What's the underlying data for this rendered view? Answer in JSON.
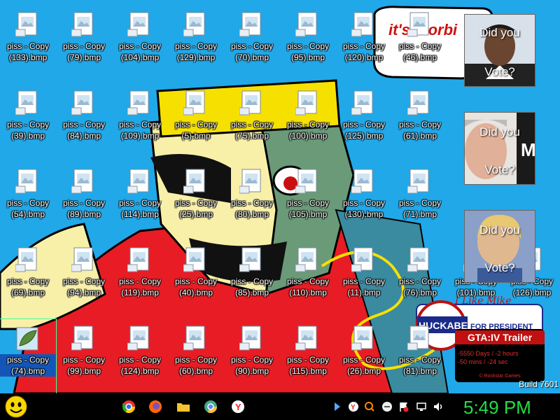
{
  "desktop": {
    "icons": [
      {
        "label": "piss - Copy\n(133).bmp"
      },
      {
        "label": "piss - Copy\n(79).bmp"
      },
      {
        "label": "piss - Copy\n(104).bmp"
      },
      {
        "label": "piss - Copy\n(129).bmp"
      },
      {
        "label": "piss - Copy\n(70).bmp"
      },
      {
        "label": "piss - Copy\n(95).bmp"
      },
      {
        "label": "piss - Copy\n(120).bmp"
      },
      {
        "label": "piss - Copy\n(46).bmp"
      },
      {
        "label": "piss - Copy\n(39).bmp"
      },
      {
        "label": "piss - Copy\n(84).bmp"
      },
      {
        "label": "piss - Copy\n(109).bmp"
      },
      {
        "label": "piss - Copy\n(5).bmp"
      },
      {
        "label": "piss - Copy\n(75).bmp"
      },
      {
        "label": "piss - Copy\n(100).bmp"
      },
      {
        "label": "piss - Copy\n(125).bmp"
      },
      {
        "label": "piss - Copy\n(61).bmp"
      },
      {
        "label": "piss - Copy\n(54).bmp"
      },
      {
        "label": "piss - Copy\n(89).bmp"
      },
      {
        "label": "piss - Copy\n(114).bmp"
      },
      {
        "label": "piss - Copy\n(25).bmp"
      },
      {
        "label": "piss - Copy\n(80).bmp"
      },
      {
        "label": "piss - Copy\n(105).bmp"
      },
      {
        "label": "piss - Copy\n(130).bmp"
      },
      {
        "label": "piss - Copy\n(71).bmp"
      },
      {
        "label": "piss - Copy\n(69).bmp"
      },
      {
        "label": "piss - Copy\n(94).bmp"
      },
      {
        "label": "piss - Copy\n(119).bmp"
      },
      {
        "label": "piss - Copy\n(40).bmp"
      },
      {
        "label": "piss - Copy\n(85).bmp"
      },
      {
        "label": "piss - Copy\n(110).bmp"
      },
      {
        "label": "piss - Copy\n(11).bmp"
      },
      {
        "label": "piss - Copy\n(76).bmp"
      },
      {
        "label": "piss - Copy\n(101).bmp"
      },
      {
        "label": "piss - Copy\n(126).bmp"
      },
      {
        "label": "piss - Copy\n(74).bmp"
      },
      {
        "label": "piss - Copy\n(99).bmp"
      },
      {
        "label": "piss - Copy\n(124).bmp"
      },
      {
        "label": "piss - Copy\n(60).bmp"
      },
      {
        "label": "piss - Copy\n(90).bmp"
      },
      {
        "label": "piss - Copy\n(115).bmp"
      },
      {
        "label": "piss - Copy\n(26).bmp"
      },
      {
        "label": "piss - Copy\n(81).bmp"
      }
    ],
    "selected_icon_index": 34,
    "wallpaper": {
      "speech_text": "it's morbi",
      "huckabee_name": "HUCKABEE",
      "huckabee_tag": "FOR PRESIDENT",
      "huckabee_script": "I Like Mike"
    },
    "build_label": "Build 7601"
  },
  "gadgets": {
    "vote_1": {
      "line1": "Did you",
      "line2": "Vote?"
    },
    "vote_2": {
      "line1": "Did you",
      "line2": "Vote?"
    },
    "vote_3": {
      "line1": "Did you",
      "line2": "Vote?"
    },
    "gta": {
      "title": "GTA:IV Trailer",
      "countdown": "-5550 Days / -2 hours",
      "countdown2": "-50 mins / -24 sec",
      "footer": "© Rockstar Games"
    }
  },
  "taskbar": {
    "start_icon": "smiley-start-icon",
    "pinned": [
      "chrome-icon",
      "firefox-icon",
      "folder-icon",
      "chromium-icon",
      "yandex-icon"
    ],
    "tray": [
      "arrow-icon",
      "yandex-icon",
      "search-icon",
      "minus-icon",
      "flag-icon",
      "network-icon",
      "volume-icon"
    ],
    "clock": "5:49 PM"
  },
  "colors": {
    "desktop_bg": "#20a8e8",
    "taskbar_bg": "#000000",
    "clock": "#22dd44"
  }
}
